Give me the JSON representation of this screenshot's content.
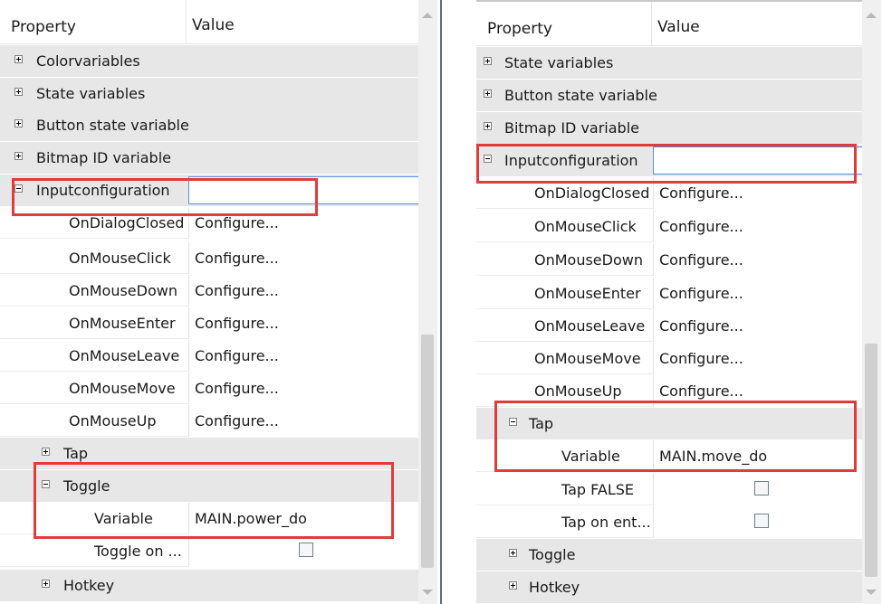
{
  "left_panel": {
    "header": {
      "property": "Property",
      "value": "Value"
    },
    "categories": {
      "color_variables": "Colorvariables",
      "state_variables": "State variables",
      "button_state_variable": "Button state variable",
      "bitmap_id_variable": "Bitmap ID variable",
      "input_configuration": "Inputconfiguration"
    },
    "events": [
      {
        "name": "OnDialogClosed",
        "value": "Configure..."
      },
      {
        "name": "OnMouseClick",
        "value": "Configure..."
      },
      {
        "name": "OnMouseDown",
        "value": "Configure..."
      },
      {
        "name": "OnMouseEnter",
        "value": "Configure..."
      },
      {
        "name": "OnMouseLeave",
        "value": "Configure..."
      },
      {
        "name": "OnMouseMove",
        "value": "Configure..."
      },
      {
        "name": "OnMouseUp",
        "value": "Configure..."
      }
    ],
    "tap": "Tap",
    "toggle": "Toggle",
    "toggle_variable": {
      "name": "Variable",
      "value": "MAIN.power_do"
    },
    "toggle_on": {
      "name": "Toggle on ...",
      "checked": false
    },
    "hotkey": "Hotkey"
  },
  "right_panel": {
    "header": {
      "property": "Property",
      "value": "Value"
    },
    "categories": {
      "state_variables": "State variables",
      "button_state_variable": "Button state variable",
      "bitmap_id_variable": "Bitmap ID variable",
      "input_configuration": "Inputconfiguration"
    },
    "events": [
      {
        "name": "OnDialogClosed",
        "value": "Configure..."
      },
      {
        "name": "OnMouseClick",
        "value": "Configure..."
      },
      {
        "name": "OnMouseDown",
        "value": "Configure..."
      },
      {
        "name": "OnMouseEnter",
        "value": "Configure..."
      },
      {
        "name": "OnMouseLeave",
        "value": "Configure..."
      },
      {
        "name": "OnMouseMove",
        "value": "Configure..."
      },
      {
        "name": "OnMouseUp",
        "value": "Configure..."
      }
    ],
    "tap": "Tap",
    "tap_variable": {
      "name": "Variable",
      "value": "MAIN.move_do"
    },
    "tap_false": {
      "name": "Tap FALSE",
      "checked": false
    },
    "tap_on_enter": {
      "name": "Tap on ent...",
      "checked": false
    },
    "toggle": "Toggle",
    "hotkey": "Hotkey"
  },
  "icons": {
    "collapsed": "plus-expander-icon",
    "expanded": "minus-expander-icon",
    "checkbox": "checkbox-icon"
  },
  "colors": {
    "highlight": "#e03c3c",
    "category_background": "#e7e7e7",
    "selection_border": "#5a8fd6",
    "scrollbar_track": "#f0f0f0"
  }
}
